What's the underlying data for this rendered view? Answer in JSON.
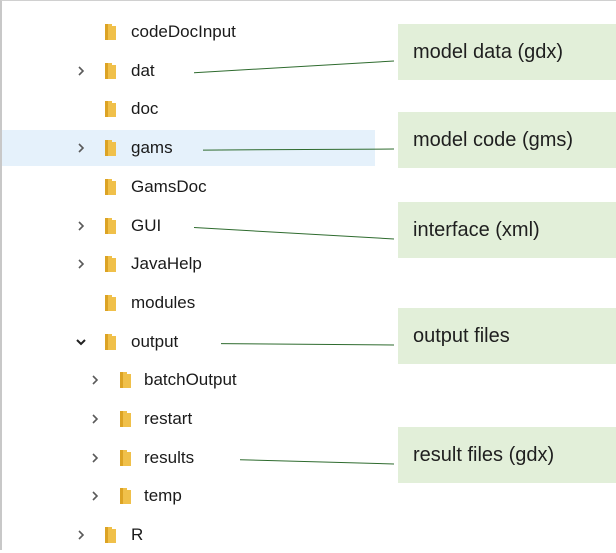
{
  "tree": {
    "items": [
      {
        "label": "codeDocInput",
        "level": 0,
        "expandable": false,
        "expanded": false,
        "selected": false
      },
      {
        "label": "dat",
        "level": 0,
        "expandable": true,
        "expanded": false,
        "selected": false
      },
      {
        "label": "doc",
        "level": 0,
        "expandable": false,
        "expanded": false,
        "selected": false
      },
      {
        "label": "gams",
        "level": 0,
        "expandable": true,
        "expanded": false,
        "selected": true
      },
      {
        "label": "GamsDoc",
        "level": 0,
        "expandable": false,
        "expanded": false,
        "selected": false
      },
      {
        "label": "GUI",
        "level": 0,
        "expandable": true,
        "expanded": false,
        "selected": false
      },
      {
        "label": "JavaHelp",
        "level": 0,
        "expandable": true,
        "expanded": false,
        "selected": false
      },
      {
        "label": "modules",
        "level": 0,
        "expandable": false,
        "expanded": false,
        "selected": false
      },
      {
        "label": "output",
        "level": 0,
        "expandable": true,
        "expanded": true,
        "selected": false
      },
      {
        "label": "batchOutput",
        "level": 1,
        "expandable": true,
        "expanded": false,
        "selected": false
      },
      {
        "label": "restart",
        "level": 1,
        "expandable": true,
        "expanded": false,
        "selected": false
      },
      {
        "label": "results",
        "level": 1,
        "expandable": true,
        "expanded": false,
        "selected": false
      },
      {
        "label": "temp",
        "level": 1,
        "expandable": true,
        "expanded": false,
        "selected": false
      },
      {
        "label": "R",
        "level": 0,
        "expandable": true,
        "expanded": false,
        "selected": false
      }
    ]
  },
  "callouts": [
    {
      "text": "model data (gdx)",
      "target": "dat"
    },
    {
      "text": "model code (gms)",
      "target": "gams"
    },
    {
      "text": "interface (xml)",
      "target": "GUI"
    },
    {
      "text": "output files",
      "target": "output"
    },
    {
      "text": "result files (gdx)",
      "target": "results"
    }
  ],
  "colors": {
    "folder": "#f0c04a",
    "folder_dark": "#dca324",
    "selection": "#e5f1fb",
    "callout_bg": "#e2efd9",
    "connector": "#2e6b2e",
    "chevron": "#5a5a5a"
  },
  "icons": {
    "folder": "folder-icon",
    "collapsed": "chevron-right-icon",
    "expanded": "chevron-down-icon"
  }
}
